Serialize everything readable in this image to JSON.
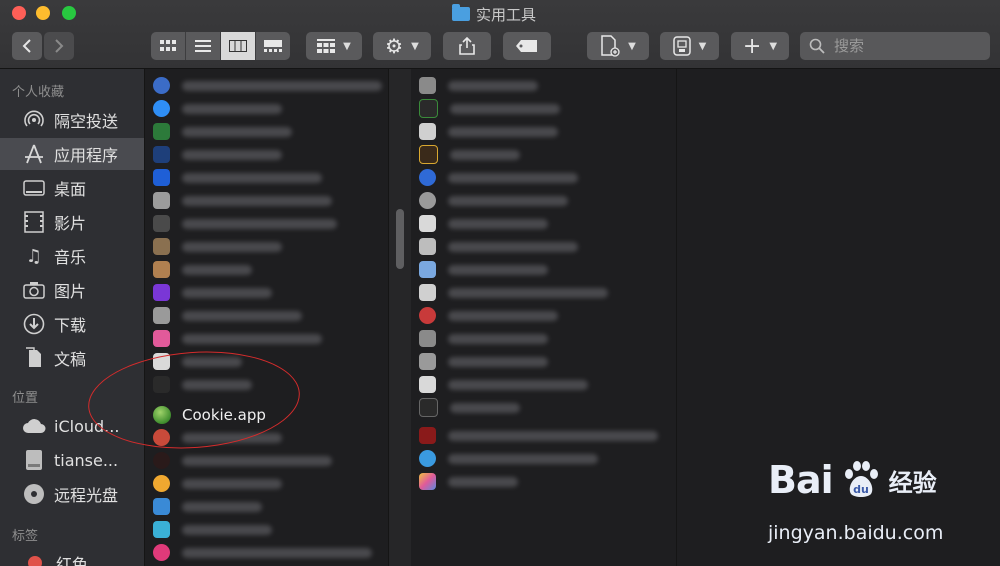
{
  "window": {
    "title": "实用工具",
    "traffic_lights": [
      "close",
      "minimize",
      "zoom"
    ]
  },
  "toolbar": {
    "back_icon": "chevron-left-icon",
    "forward_icon": "chevron-right-icon",
    "view_modes": [
      "icon-view",
      "list-view",
      "column-view",
      "gallery-view"
    ],
    "active_view": "column-view",
    "search": {
      "placeholder": "搜索"
    }
  },
  "sidebar": {
    "favorites_title": "个人收藏",
    "favorites": [
      {
        "label": "隔空投送",
        "icon": "airdrop-icon"
      },
      {
        "label": "应用程序",
        "icon": "applications-icon",
        "selected": true
      },
      {
        "label": "桌面",
        "icon": "desktop-icon"
      },
      {
        "label": "影片",
        "icon": "movies-icon"
      },
      {
        "label": "音乐",
        "icon": "music-icon"
      },
      {
        "label": "图片",
        "icon": "pictures-icon"
      },
      {
        "label": "下载",
        "icon": "downloads-icon"
      },
      {
        "label": "文稿",
        "icon": "documents-icon"
      }
    ],
    "locations_title": "位置",
    "locations": [
      {
        "label": "iCloud...",
        "icon": "cloud-icon"
      },
      {
        "label": "tianse...",
        "icon": "disk-icon"
      },
      {
        "label": "远程光盘",
        "icon": "disc-icon"
      }
    ],
    "tags_title": "标签",
    "tags": [
      {
        "label": "红色",
        "color": "#e0524a"
      }
    ]
  },
  "column1": {
    "focused_item": "Cookie.app",
    "blurred_rows": 22
  },
  "column2": {
    "blurred_rows": 18
  },
  "watermark": {
    "brand": "Bai",
    "brand_suffix": "du",
    "cn": "经验",
    "url": "jingyan.baidu.com"
  }
}
